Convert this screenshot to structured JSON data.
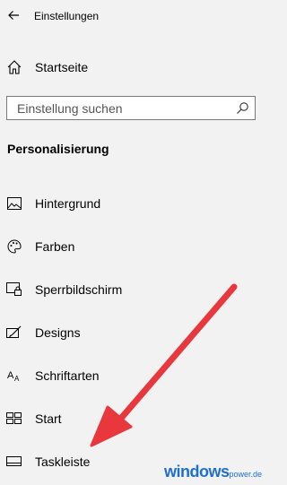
{
  "window": {
    "title": "Einstellungen"
  },
  "home": {
    "label": "Startseite"
  },
  "search": {
    "placeholder": "Einstellung suchen"
  },
  "section": {
    "title": "Personalisierung"
  },
  "nav": {
    "items": [
      {
        "label": "Hintergrund",
        "icon": "picture-icon"
      },
      {
        "label": "Farben",
        "icon": "palette-icon"
      },
      {
        "label": "Sperrbildschirm",
        "icon": "lock-screen-icon"
      },
      {
        "label": "Designs",
        "icon": "brush-icon"
      },
      {
        "label": "Schriftarten",
        "icon": "font-icon"
      },
      {
        "label": "Start",
        "icon": "start-tiles-icon"
      },
      {
        "label": "Taskleiste",
        "icon": "taskbar-icon"
      }
    ]
  },
  "annotation": {
    "arrow_color": "#e8383d"
  },
  "watermark": {
    "brand": "windows",
    "suffix": "power.de"
  }
}
